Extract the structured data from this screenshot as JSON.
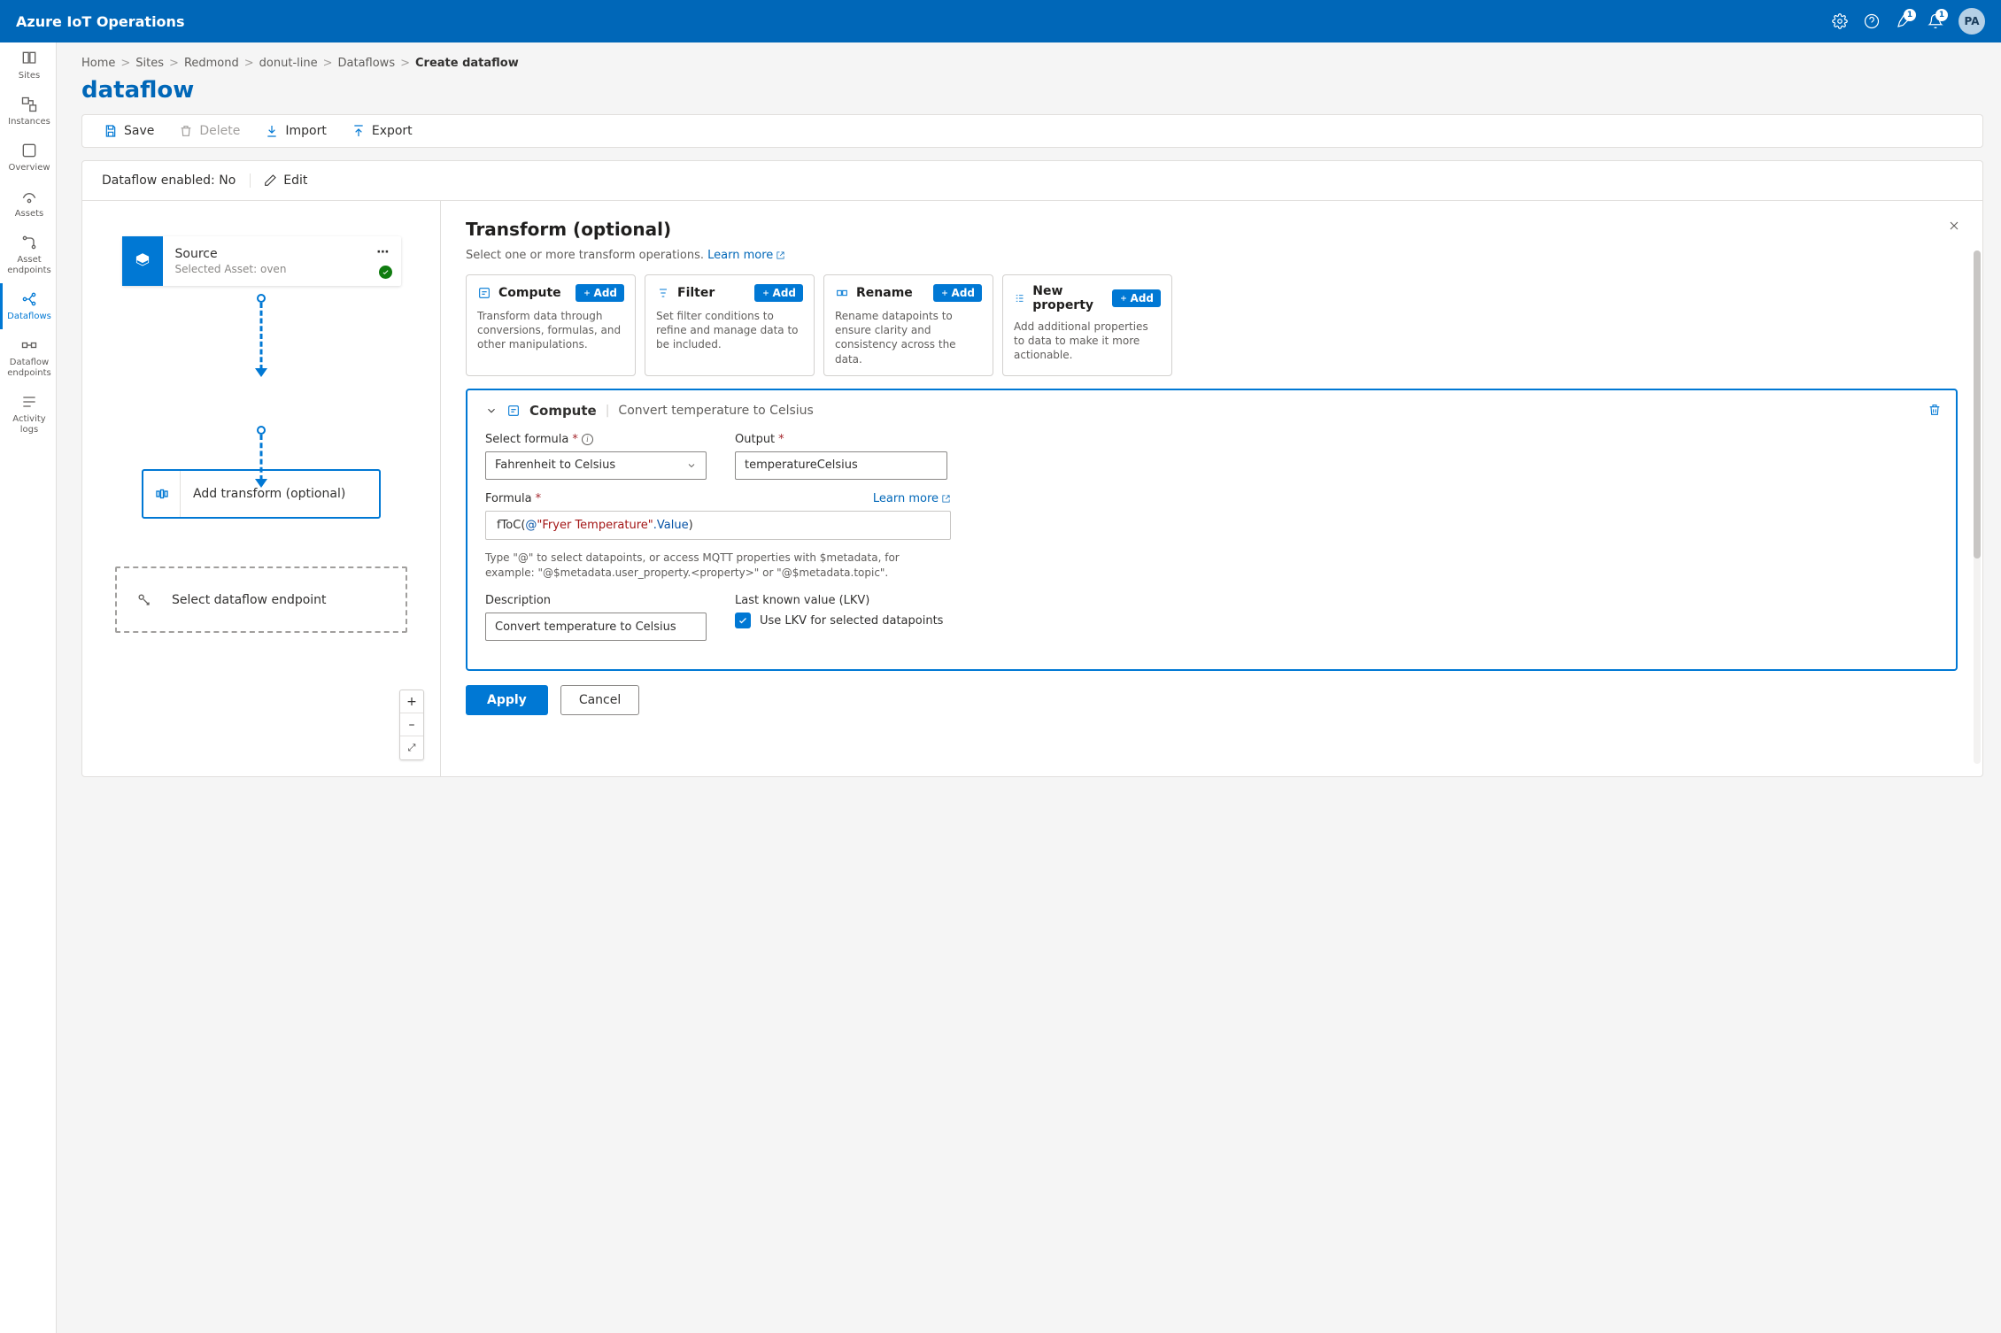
{
  "header": {
    "product": "Azure IoT Operations",
    "notif1_count": "1",
    "notif2_count": "1",
    "avatar_initials": "PA"
  },
  "sidebar": {
    "items": [
      {
        "label": "Sites"
      },
      {
        "label": "Instances"
      },
      {
        "label": "Overview"
      },
      {
        "label": "Assets"
      },
      {
        "label": "Asset endpoints"
      },
      {
        "label": "Dataflows"
      },
      {
        "label": "Dataflow endpoints"
      },
      {
        "label": "Activity logs"
      }
    ]
  },
  "breadcrumbs": {
    "home": "Home",
    "sites": "Sites",
    "site": "Redmond",
    "instance": "donut-line",
    "dataflows": "Dataflows",
    "current": "Create dataflow"
  },
  "page": {
    "title": "dataflow"
  },
  "toolbar": {
    "save": "Save",
    "delete": "Delete",
    "import": "Import",
    "export": "Export"
  },
  "status": {
    "enabled_label": "Dataflow enabled: No",
    "edit": "Edit"
  },
  "canvas": {
    "source": {
      "title": "Source",
      "subtitle": "Selected Asset: oven"
    },
    "transform": {
      "label": "Add transform (optional)"
    },
    "endpoint": {
      "label": "Select dataflow endpoint"
    },
    "zoom": {
      "in": "+",
      "out": "–",
      "fit": "⤢"
    }
  },
  "panel": {
    "title": "Transform (optional)",
    "subtitle": "Select one or more transform operations.",
    "learn_more": "Learn more",
    "ops": [
      {
        "name": "Compute",
        "desc": "Transform data through conversions, formulas, and other manipulations.",
        "add": "Add"
      },
      {
        "name": "Filter",
        "desc": "Set filter conditions to refine and manage data to be included.",
        "add": "Add"
      },
      {
        "name": "Rename",
        "desc": "Rename datapoints to ensure clarity and consistency across the data.",
        "add": "Add"
      },
      {
        "name": "New property",
        "desc": "Add additional properties to data to make it more actionable.",
        "add": "Add"
      }
    ],
    "compute_block": {
      "head_type": "Compute",
      "head_name": "Convert temperature to Celsius",
      "formula_label": "Select formula",
      "formula_value": "Fahrenheit to Celsius",
      "output_label": "Output",
      "output_value": "temperatureCelsius",
      "formula_field_label": "Formula",
      "formula_fn": "fToC",
      "formula_str": "\"Fryer Temperature\"",
      "formula_prop": ".Value",
      "formula_hint": "Type \"@\" to select datapoints, or access MQTT properties with $metadata, for example: \"@$metadata.user_property.<property>\" or \"@$metadata.topic\".",
      "desc_label": "Description",
      "desc_value": "Convert temperature to Celsius",
      "lkv_label": "Last known value (LKV)",
      "lkv_check_label": "Use LKV for selected datapoints",
      "learn_more": "Learn more"
    },
    "apply": "Apply",
    "cancel": "Cancel"
  }
}
